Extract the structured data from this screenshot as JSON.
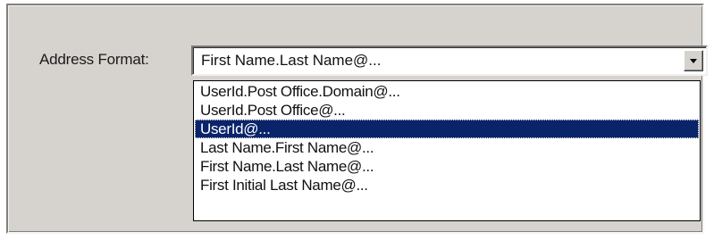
{
  "address_format": {
    "label": "Address Format:",
    "selected_value": "First Name.Last Name@...",
    "dropdown_icon": "chevron-down-icon",
    "options": [
      "UserId.Post Office.Domain@...",
      "UserId.Post Office@...",
      "UserId@...",
      "Last Name.First Name@...",
      "First Name.Last Name@...",
      "First Initial Last Name@..."
    ],
    "highlighted_option": "UserId@..."
  },
  "colors": {
    "panel_background": "#d6d3ce",
    "highlight_background": "#0a246a",
    "highlight_text": "#ffffff"
  }
}
